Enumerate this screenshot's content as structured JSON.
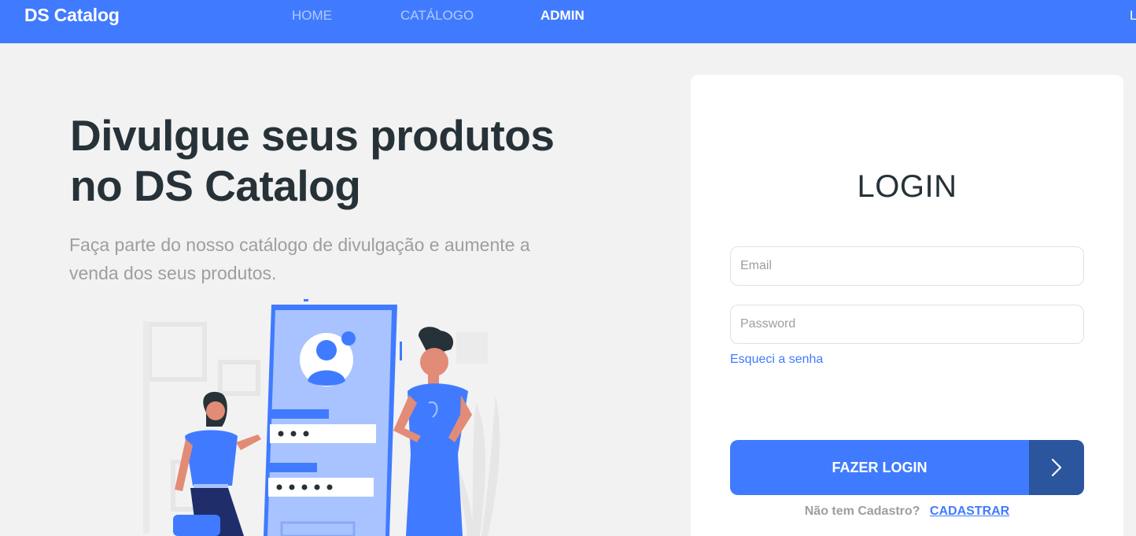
{
  "navbar": {
    "brand": "DS Catalog",
    "links": [
      {
        "label": "HOME",
        "active": false
      },
      {
        "label": "CATÁLOGO",
        "active": false
      },
      {
        "label": "ADMIN",
        "active": true
      }
    ],
    "login_label": "L"
  },
  "hero": {
    "title_line1": "Divulgue seus produtos",
    "title_line2": "no DS Catalog",
    "subtitle_line1": "Faça parte do nosso catálogo de divulgação e aumente a",
    "subtitle_line2": "venda dos seus produtos."
  },
  "login": {
    "title": "LOGIN",
    "email_placeholder": "Email",
    "password_placeholder": "Password",
    "forgot_label": "Esqueci a senha",
    "submit_label": "FAZER LOGIN",
    "no_account_text": "Não tem Cadastro?",
    "signup_label": "CADASTRAR"
  },
  "colors": {
    "primary": "#407bff",
    "primary_dark": "#2b569e",
    "text_dark": "#263238",
    "text_muted": "#9e9e9e",
    "background": "#f2f2f2"
  },
  "icons": {
    "submit": "chevron-right-icon",
    "illustration": "login-illustration"
  }
}
